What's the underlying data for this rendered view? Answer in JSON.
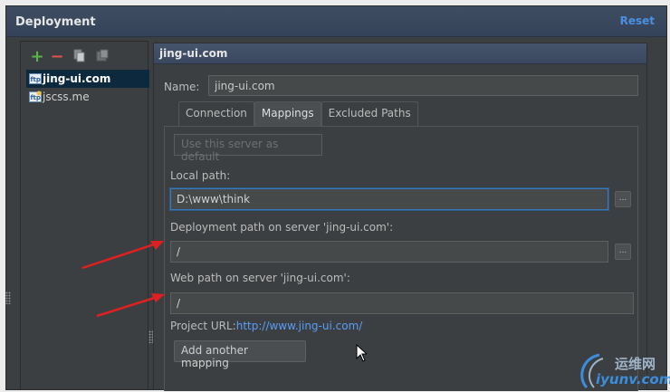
{
  "window": {
    "title": "Deployment",
    "reset_label": "Reset"
  },
  "toolbar": {
    "add_icon": "plus-icon",
    "remove_icon": "minus-icon",
    "copy_icon": "copy-icon",
    "default_icon": "server-icon"
  },
  "servers": [
    {
      "label": "jing-ui.com",
      "selected": true
    },
    {
      "label": "jscss.me",
      "selected": false
    }
  ],
  "server_detail": {
    "header": "jing-ui.com",
    "name_label": "Name:",
    "name_value": "jing-ui.com"
  },
  "tabs": [
    {
      "label": "Connection"
    },
    {
      "label": "Mappings",
      "active": true
    },
    {
      "label": "Excluded Paths"
    }
  ],
  "mappings": {
    "default_button": "Use this server as default",
    "local_path_label": "Local path:",
    "local_path_value": "D:\\www\\think",
    "deployment_path_label": "Deployment path on server 'jing-ui.com':",
    "deployment_path_value": "/",
    "web_path_label": "Web path on server 'jing-ui.com':",
    "web_path_value": "/",
    "project_url_label": "Project URL:",
    "project_url_value": "http://www.jing-ui.com/",
    "add_mapping_button": "Add another mapping",
    "browse_label": "..."
  },
  "watermark": {
    "cn": "运维网",
    "en": "iyunv.com"
  },
  "colors": {
    "accent": "#4a90e2",
    "link": "#589df6",
    "arrow": "#e02020",
    "add": "#58b54a",
    "remove": "#d9534f"
  }
}
